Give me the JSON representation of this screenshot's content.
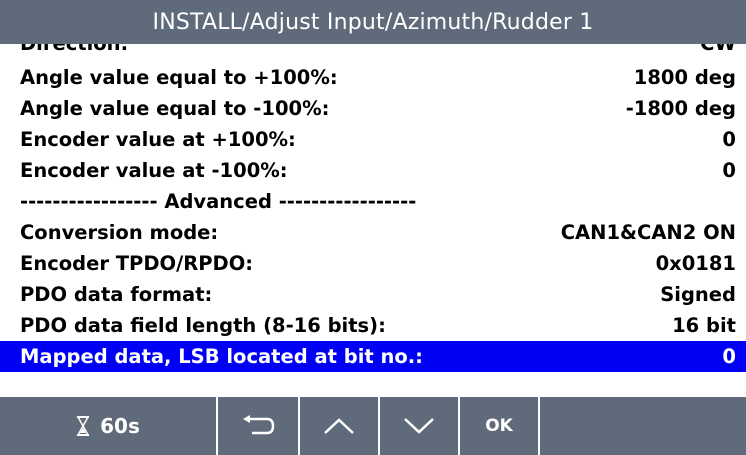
{
  "title": "INSTALL/Adjust Input/Azimuth/Rudder 1",
  "rows": [
    {
      "label": "Direction:",
      "value": "CW"
    },
    {
      "label": "Angle value equal to +100%:",
      "value": "1800 deg"
    },
    {
      "label": "Angle value equal to -100%:",
      "value": "-1800 deg"
    },
    {
      "label": "Encoder value at +100%:",
      "value": "0"
    },
    {
      "label": "Encoder value at -100%:",
      "value": "0"
    },
    {
      "label": "----------------- Advanced -----------------",
      "value": ""
    },
    {
      "label": "Conversion mode:",
      "value": "CAN1&CAN2 ON"
    },
    {
      "label": "Encoder TPDO/RPDO:",
      "value": "0x0181"
    },
    {
      "label": "PDO data format:",
      "value": "Signed"
    },
    {
      "label": "PDO data field length (8-16 bits):",
      "value": "16 bit"
    },
    {
      "label": "Mapped data, LSB located at bit no.:",
      "value": "0"
    }
  ],
  "bottom_bar": {
    "timer_icon": "hourglass-icon",
    "timer_label": "60s",
    "back_icon": "back-arrow-icon",
    "up_icon": "chevron-up-icon",
    "down_icon": "chevron-down-icon",
    "ok_label": "OK"
  },
  "colors": {
    "bar_background": "#5f6a7a",
    "selection": "#0000f5"
  }
}
